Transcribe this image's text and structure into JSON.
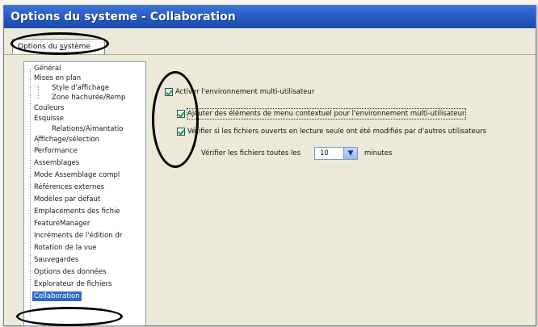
{
  "window": {
    "title": "Options du systeme - Collaboration"
  },
  "tab": {
    "label_prefix": "Options du ",
    "label_accel": "s",
    "label_suffix": "ystème"
  },
  "tree": {
    "items": [
      {
        "label": "Général"
      },
      {
        "label": "Mises en plan"
      },
      {
        "label": "Style d'affichage"
      },
      {
        "label": "Zone hachurée/Remp"
      },
      {
        "label": "Couleurs"
      },
      {
        "label": "Esquisse"
      },
      {
        "label": "Relations/Aimantatio"
      },
      {
        "label": "Affichage/sélection"
      },
      {
        "label": "Performance"
      },
      {
        "label": "Assemblages"
      },
      {
        "label": "Mode Assemblage compl"
      },
      {
        "label": "Références externes"
      },
      {
        "label": "Modèles par défaut"
      },
      {
        "label": "Emplacements des fichie"
      },
      {
        "label": "FeatureManager"
      },
      {
        "label": "Incréments de l'édition dr"
      },
      {
        "label": "Rotation de la vue"
      },
      {
        "label": "Sauvegardes"
      },
      {
        "label": "Options des données"
      },
      {
        "label": "Explorateur de fichiers"
      },
      {
        "label": "Collaboration"
      }
    ]
  },
  "options": {
    "multi_user_env": {
      "label": "Activer l'environnement multi-utilisateur",
      "checked": true
    },
    "context_menu": {
      "label": "Ajouter des éléments de menu contextuel pour l'environnement multi-utilisateur",
      "checked": true
    },
    "check_readonly": {
      "label": "Vérifier si les fichiers ouverts en lecture seule ont été modifiés par d'autres utilisateurs",
      "checked": true
    },
    "interval": {
      "label": "Vérifier les fichiers toutes les",
      "value": "10",
      "unit": "minutes"
    }
  }
}
